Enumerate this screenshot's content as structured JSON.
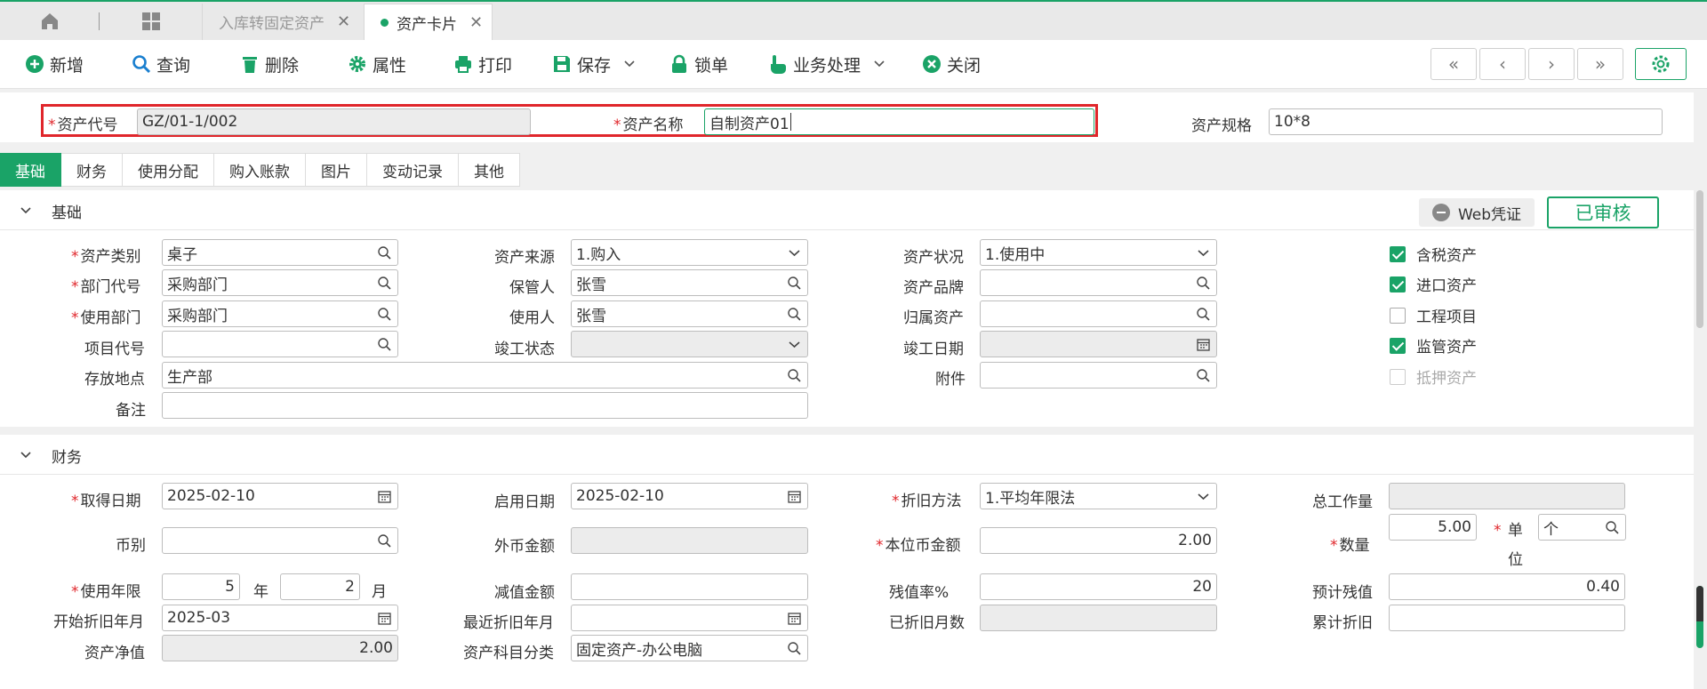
{
  "tabs": {
    "tab1": "入库转固定资产",
    "tab2": "资产卡片"
  },
  "toolbar": {
    "new": "新增",
    "query": "查询",
    "delete": "删除",
    "props": "属性",
    "print": "打印",
    "save": "保存",
    "lock": "锁单",
    "business": "业务处理",
    "close": "关闭"
  },
  "header": {
    "code_label": "资产代号",
    "code_value": "GZ/01-1/002",
    "name_label": "资产名称",
    "name_value": "自制资产01",
    "spec_label": "资产规格",
    "spec_value": "10*8"
  },
  "section_tabs": [
    "基础",
    "财务",
    "使用分配",
    "购入账款",
    "图片",
    "变动记录",
    "其他"
  ],
  "basic": {
    "title": "基础",
    "web_voucher": "Web凭证",
    "status": "已审核",
    "category_label": "资产类别",
    "category_value": "桌子",
    "dept_label": "部门代号",
    "dept_value": "采购部门",
    "use_dept_label": "使用部门",
    "use_dept_value": "采购部门",
    "project_label": "项目代号",
    "project_value": "",
    "location_label": "存放地点",
    "location_value": "生产部",
    "remark_label": "备注",
    "remark_value": "",
    "source_label": "资产来源",
    "source_value": "1.购入",
    "keeper_label": "保管人",
    "keeper_value": "张雪",
    "user_label": "使用人",
    "user_value": "张雪",
    "completion_status_label": "竣工状态",
    "completion_status_value": "",
    "condition_label": "资产状况",
    "condition_value": "1.使用中",
    "brand_label": "资产品牌",
    "brand_value": "",
    "parent_label": "归属资产",
    "parent_value": "",
    "completion_date_label": "竣工日期",
    "completion_date_value": "",
    "attachment_label": "附件",
    "attachment_value": "",
    "checks": [
      {
        "label": "含税资产",
        "checked": true
      },
      {
        "label": "进口资产",
        "checked": true
      },
      {
        "label": "工程项目",
        "checked": false
      },
      {
        "label": "监管资产",
        "checked": true
      },
      {
        "label": "抵押资产",
        "checked": false,
        "disabled": true
      }
    ]
  },
  "finance": {
    "title": "财务",
    "acq_date_label": "取得日期",
    "acq_date_value": "2025-02-10",
    "currency_label": "币别",
    "currency_value": "",
    "life_label": "使用年限",
    "life_years": "5",
    "year_unit": "年",
    "life_months": "2",
    "month_unit": "月",
    "dep_start_label": "开始折旧年月",
    "dep_start_value": "2025-03",
    "net_label": "资产净值",
    "net_value": "2.00",
    "start_date_label": "启用日期",
    "start_date_value": "2025-02-10",
    "fx_amount_label": "外币金额",
    "fx_amount_value": "",
    "impair_label": "减值金额",
    "impair_value": "",
    "last_dep_label": "最近折旧年月",
    "last_dep_value": "",
    "subject_label": "资产科目分类",
    "subject_value": "固定资产-办公电脑",
    "method_label": "折旧方法",
    "method_value": "1.平均年限法",
    "local_amount_label": "本位币金额",
    "local_amount_value": "2.00",
    "residual_rate_label": "残值率%",
    "residual_rate_value": "20",
    "dep_months_label": "已折旧月数",
    "dep_months_value": "",
    "workload_label": "总工作量",
    "workload_value": "",
    "qty_label": "数量",
    "qty_value": "5.00",
    "unit_label_1": "单",
    "unit_label_2": "位",
    "unit_value": "个",
    "est_residual_label": "预计残值",
    "est_residual_value": "0.40",
    "acc_dep_label": "累计折旧",
    "acc_dep_value": ""
  }
}
